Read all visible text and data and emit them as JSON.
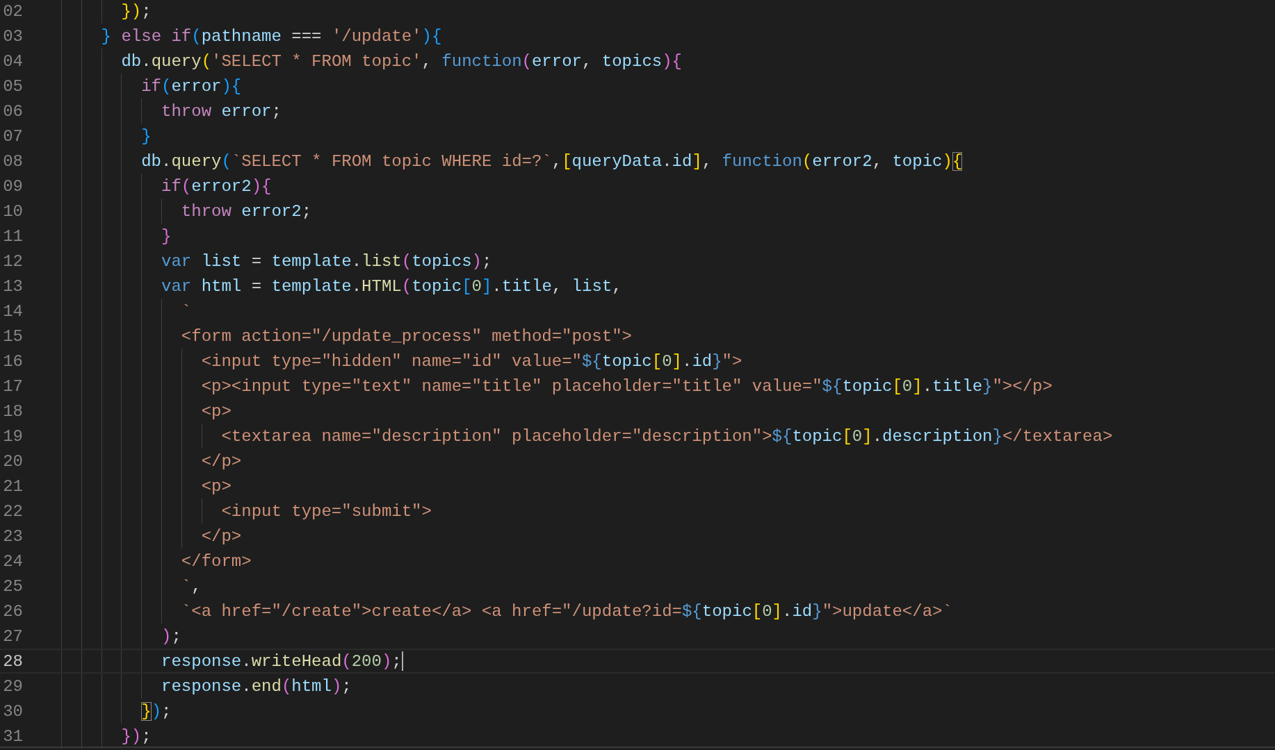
{
  "editor": {
    "lines": [
      {
        "number": "02",
        "current": false,
        "tokens": [
          {
            "kind": "bracket1",
            "text": "      })"
          },
          {
            "kind": "punct",
            "text": ";"
          }
        ]
      },
      {
        "number": "03",
        "current": false,
        "tokens": [
          {
            "kind": "bracket3",
            "text": "    }"
          },
          {
            "kind": "keyword",
            "text": " else"
          },
          {
            "kind": "keyword",
            "text": " if"
          },
          {
            "kind": "bracket3",
            "text": "("
          },
          {
            "kind": "variable",
            "text": "pathname"
          },
          {
            "kind": "punct",
            "text": " === "
          },
          {
            "kind": "string",
            "text": "'/update'"
          },
          {
            "kind": "bracket3",
            "text": "){"
          }
        ]
      },
      {
        "number": "04",
        "current": false,
        "tokens": [
          {
            "kind": "variable",
            "text": "      db"
          },
          {
            "kind": "punct",
            "text": "."
          },
          {
            "kind": "function",
            "text": "query"
          },
          {
            "kind": "bracket1",
            "text": "("
          },
          {
            "kind": "string",
            "text": "'SELECT * FROM topic'"
          },
          {
            "kind": "punct",
            "text": ", "
          },
          {
            "kind": "storage",
            "text": "function"
          },
          {
            "kind": "bracket2",
            "text": "("
          },
          {
            "kind": "variable",
            "text": "error"
          },
          {
            "kind": "punct",
            "text": ", "
          },
          {
            "kind": "variable",
            "text": "topics"
          },
          {
            "kind": "bracket2",
            "text": "){"
          }
        ]
      },
      {
        "number": "05",
        "current": false,
        "tokens": [
          {
            "kind": "keyword",
            "text": "        if"
          },
          {
            "kind": "bracket3",
            "text": "("
          },
          {
            "kind": "variable",
            "text": "error"
          },
          {
            "kind": "bracket3",
            "text": "){"
          }
        ]
      },
      {
        "number": "06",
        "current": false,
        "tokens": [
          {
            "kind": "keyword",
            "text": "          throw"
          },
          {
            "kind": "variable",
            "text": " error"
          },
          {
            "kind": "punct",
            "text": ";"
          }
        ]
      },
      {
        "number": "07",
        "current": false,
        "tokens": [
          {
            "kind": "bracket3",
            "text": "        }"
          }
        ]
      },
      {
        "number": "08",
        "current": false,
        "tokens": [
          {
            "kind": "variable",
            "text": "        db"
          },
          {
            "kind": "punct",
            "text": "."
          },
          {
            "kind": "function",
            "text": "query"
          },
          {
            "kind": "bracket3",
            "text": "("
          },
          {
            "kind": "string",
            "text": "`SELECT * FROM topic WHERE id=?`"
          },
          {
            "kind": "punct",
            "text": ","
          },
          {
            "kind": "bracket1",
            "text": "["
          },
          {
            "kind": "variable",
            "text": "queryData"
          },
          {
            "kind": "punct",
            "text": "."
          },
          {
            "kind": "variable",
            "text": "id"
          },
          {
            "kind": "bracket1",
            "text": "]"
          },
          {
            "kind": "punct",
            "text": ", "
          },
          {
            "kind": "storage",
            "text": "function"
          },
          {
            "kind": "bracket1",
            "text": "("
          },
          {
            "kind": "variable",
            "text": "error2"
          },
          {
            "kind": "punct",
            "text": ", "
          },
          {
            "kind": "variable",
            "text": "topic"
          },
          {
            "kind": "bracket1",
            "text": ")"
          },
          {
            "kind": "match",
            "text": "{"
          }
        ]
      },
      {
        "number": "09",
        "current": false,
        "tokens": [
          {
            "kind": "keyword",
            "text": "          if"
          },
          {
            "kind": "bracket2",
            "text": "("
          },
          {
            "kind": "variable",
            "text": "error2"
          },
          {
            "kind": "bracket2",
            "text": "){"
          }
        ]
      },
      {
        "number": "10",
        "current": false,
        "tokens": [
          {
            "kind": "keyword",
            "text": "            throw"
          },
          {
            "kind": "variable",
            "text": " error2"
          },
          {
            "kind": "punct",
            "text": ";"
          }
        ]
      },
      {
        "number": "11",
        "current": false,
        "tokens": [
          {
            "kind": "bracket2",
            "text": "          }"
          }
        ]
      },
      {
        "number": "12",
        "current": false,
        "tokens": [
          {
            "kind": "storage",
            "text": "          var"
          },
          {
            "kind": "variable",
            "text": " list"
          },
          {
            "kind": "punct",
            "text": " = "
          },
          {
            "kind": "variable",
            "text": "template"
          },
          {
            "kind": "punct",
            "text": "."
          },
          {
            "kind": "function",
            "text": "list"
          },
          {
            "kind": "bracket2",
            "text": "("
          },
          {
            "kind": "variable",
            "text": "topics"
          },
          {
            "kind": "bracket2",
            "text": ")"
          },
          {
            "kind": "punct",
            "text": ";"
          }
        ]
      },
      {
        "number": "13",
        "current": false,
        "tokens": [
          {
            "kind": "storage",
            "text": "          var"
          },
          {
            "kind": "variable",
            "text": " html"
          },
          {
            "kind": "punct",
            "text": " = "
          },
          {
            "kind": "variable",
            "text": "template"
          },
          {
            "kind": "punct",
            "text": "."
          },
          {
            "kind": "function",
            "text": "HTML"
          },
          {
            "kind": "bracket2",
            "text": "("
          },
          {
            "kind": "variable",
            "text": "topic"
          },
          {
            "kind": "bracket3",
            "text": "["
          },
          {
            "kind": "number",
            "text": "0"
          },
          {
            "kind": "bracket3",
            "text": "]"
          },
          {
            "kind": "punct",
            "text": "."
          },
          {
            "kind": "variable",
            "text": "title"
          },
          {
            "kind": "punct",
            "text": ", "
          },
          {
            "kind": "variable",
            "text": "list"
          },
          {
            "kind": "punct",
            "text": ","
          }
        ]
      },
      {
        "number": "14",
        "current": false,
        "tokens": [
          {
            "kind": "string",
            "text": "            `"
          }
        ]
      },
      {
        "number": "15",
        "current": false,
        "tokens": [
          {
            "kind": "string",
            "text": "            <form action=\"/update_process\" method=\"post\">"
          }
        ]
      },
      {
        "number": "16",
        "current": false,
        "tokens": [
          {
            "kind": "string",
            "text": "              <input type=\"hidden\" name=\"id\" value=\""
          },
          {
            "kind": "storage",
            "text": "${"
          },
          {
            "kind": "variable",
            "text": "topic"
          },
          {
            "kind": "bracket1",
            "text": "["
          },
          {
            "kind": "number",
            "text": "0"
          },
          {
            "kind": "bracket1",
            "text": "]"
          },
          {
            "kind": "punct",
            "text": "."
          },
          {
            "kind": "variable",
            "text": "id"
          },
          {
            "kind": "storage",
            "text": "}"
          },
          {
            "kind": "string",
            "text": "\">"
          }
        ]
      },
      {
        "number": "17",
        "current": false,
        "tokens": [
          {
            "kind": "string",
            "text": "              <p><input type=\"text\" name=\"title\" placeholder=\"title\" value=\""
          },
          {
            "kind": "storage",
            "text": "${"
          },
          {
            "kind": "variable",
            "text": "topic"
          },
          {
            "kind": "bracket1",
            "text": "["
          },
          {
            "kind": "number",
            "text": "0"
          },
          {
            "kind": "bracket1",
            "text": "]"
          },
          {
            "kind": "punct",
            "text": "."
          },
          {
            "kind": "variable",
            "text": "title"
          },
          {
            "kind": "storage",
            "text": "}"
          },
          {
            "kind": "string",
            "text": "\"></p>"
          }
        ]
      },
      {
        "number": "18",
        "current": false,
        "tokens": [
          {
            "kind": "string",
            "text": "              <p>"
          }
        ]
      },
      {
        "number": "19",
        "current": false,
        "tokens": [
          {
            "kind": "string",
            "text": "                <textarea name=\"description\" placeholder=\"description\">"
          },
          {
            "kind": "storage",
            "text": "${"
          },
          {
            "kind": "variable",
            "text": "topic"
          },
          {
            "kind": "bracket1",
            "text": "["
          },
          {
            "kind": "number",
            "text": "0"
          },
          {
            "kind": "bracket1",
            "text": "]"
          },
          {
            "kind": "punct",
            "text": "."
          },
          {
            "kind": "variable",
            "text": "description"
          },
          {
            "kind": "storage",
            "text": "}"
          },
          {
            "kind": "string",
            "text": "</textarea>"
          }
        ]
      },
      {
        "number": "20",
        "current": false,
        "tokens": [
          {
            "kind": "string",
            "text": "              </p>"
          }
        ]
      },
      {
        "number": "21",
        "current": false,
        "tokens": [
          {
            "kind": "string",
            "text": "              <p>"
          }
        ]
      },
      {
        "number": "22",
        "current": false,
        "tokens": [
          {
            "kind": "string",
            "text": "                <input type=\"submit\">"
          }
        ]
      },
      {
        "number": "23",
        "current": false,
        "tokens": [
          {
            "kind": "string",
            "text": "              </p>"
          }
        ]
      },
      {
        "number": "24",
        "current": false,
        "tokens": [
          {
            "kind": "string",
            "text": "            </form>"
          }
        ]
      },
      {
        "number": "25",
        "current": false,
        "tokens": [
          {
            "kind": "string",
            "text": "            `"
          },
          {
            "kind": "punct",
            "text": ","
          }
        ]
      },
      {
        "number": "26",
        "current": false,
        "tokens": [
          {
            "kind": "string",
            "text": "            `<a href=\"/create\">create</a> <a href=\"/update?id="
          },
          {
            "kind": "storage",
            "text": "${"
          },
          {
            "kind": "variable",
            "text": "topic"
          },
          {
            "kind": "bracket1",
            "text": "["
          },
          {
            "kind": "number",
            "text": "0"
          },
          {
            "kind": "bracket1",
            "text": "]"
          },
          {
            "kind": "punct",
            "text": "."
          },
          {
            "kind": "variable",
            "text": "id"
          },
          {
            "kind": "storage",
            "text": "}"
          },
          {
            "kind": "string",
            "text": "\">update</a>`"
          }
        ]
      },
      {
        "number": "27",
        "current": false,
        "tokens": [
          {
            "kind": "bracket2",
            "text": "          )"
          },
          {
            "kind": "punct",
            "text": ";"
          }
        ]
      },
      {
        "number": "28",
        "current": true,
        "tokens": [
          {
            "kind": "variable",
            "text": "          response"
          },
          {
            "kind": "punct",
            "text": "."
          },
          {
            "kind": "function",
            "text": "writeHead"
          },
          {
            "kind": "bracket2",
            "text": "("
          },
          {
            "kind": "number",
            "text": "200"
          },
          {
            "kind": "bracket2",
            "text": ")"
          },
          {
            "kind": "punct",
            "text": ";"
          }
        ]
      },
      {
        "number": "29",
        "current": false,
        "tokens": [
          {
            "kind": "variable",
            "text": "          response"
          },
          {
            "kind": "punct",
            "text": "."
          },
          {
            "kind": "function",
            "text": "end"
          },
          {
            "kind": "bracket2",
            "text": "("
          },
          {
            "kind": "variable",
            "text": "html"
          },
          {
            "kind": "bracket2",
            "text": ")"
          },
          {
            "kind": "punct",
            "text": ";"
          }
        ]
      },
      {
        "number": "30",
        "current": false,
        "tokens": [
          {
            "kind": "match",
            "text": "        }"
          },
          {
            "kind": "bracket3",
            "text": ")"
          },
          {
            "kind": "punct",
            "text": ";"
          }
        ]
      },
      {
        "number": "31",
        "current": false,
        "tokens": [
          {
            "kind": "bracket2",
            "text": "      })"
          },
          {
            "kind": "punct",
            "text": ";"
          }
        ]
      }
    ]
  }
}
